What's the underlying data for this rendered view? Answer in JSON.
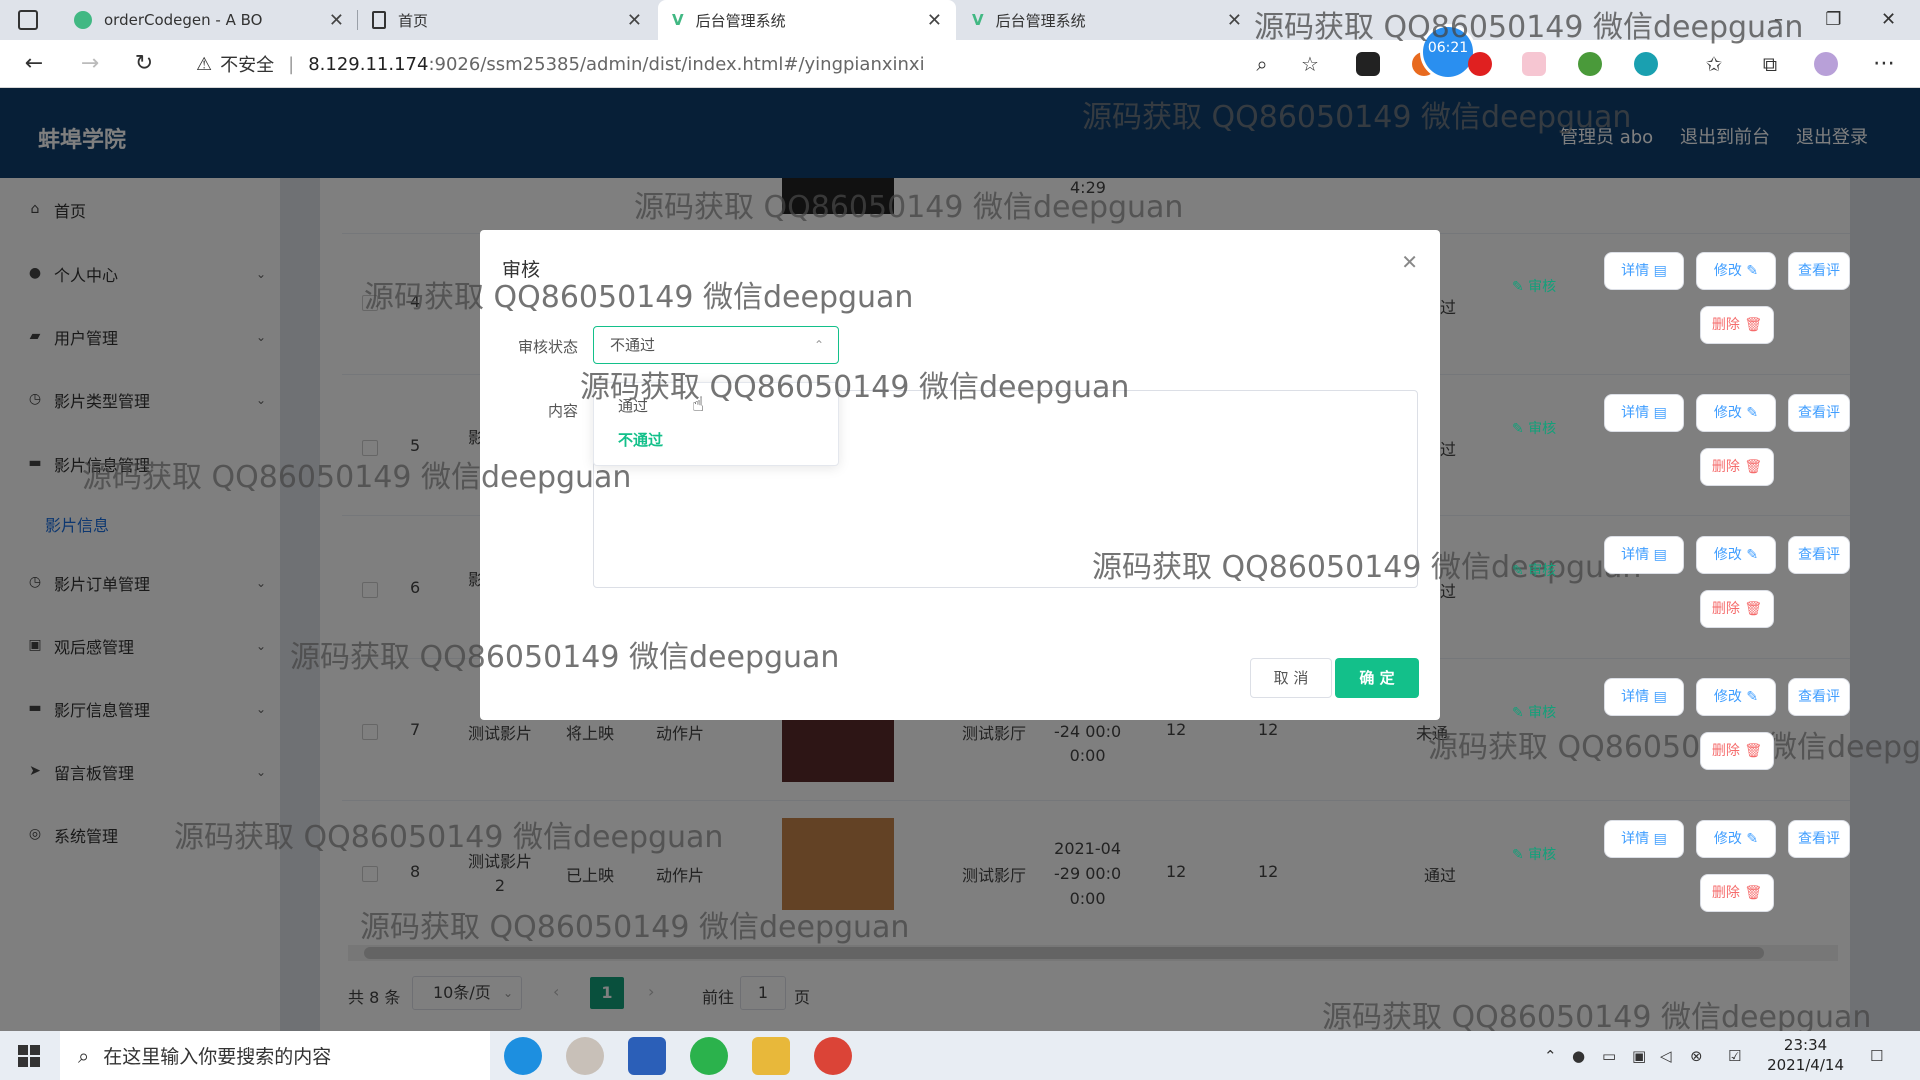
{
  "browser": {
    "tabs": [
      {
        "title": "orderCodegen - A BO"
      },
      {
        "title": "首页"
      },
      {
        "title": "后台管理系统"
      },
      {
        "title": "后台管理系统"
      }
    ],
    "security_label": "不安全",
    "url_host": "8.129.11.174",
    "url_rest": ":9026/ssm25385/admin/dist/index.html#/yingpianxinxi",
    "clock_badge": "06:21"
  },
  "header": {
    "brand": "蚌埠学院",
    "user": "管理员 abo",
    "to_front": "退出到前台",
    "logout": "退出登录"
  },
  "sidebar": {
    "items": [
      {
        "label": "首页",
        "icon": "home-icon"
      },
      {
        "label": "个人中心",
        "icon": "user-icon"
      },
      {
        "label": "用户管理",
        "icon": "users-icon"
      },
      {
        "label": "影片类型管理",
        "icon": "clock-icon"
      },
      {
        "label": "影片信息管理",
        "icon": "monitor-icon"
      },
      {
        "label": "影片订单管理",
        "icon": "clock-icon"
      },
      {
        "label": "观后感管理",
        "icon": "doc-icon"
      },
      {
        "label": "影厅信息管理",
        "icon": "monitor-icon"
      },
      {
        "label": "留言板管理",
        "icon": "send-icon"
      },
      {
        "label": "系统管理",
        "icon": "settings-icon"
      }
    ],
    "sub_item": "影片信息"
  },
  "table": {
    "rows": [
      {
        "idx": "4",
        "name": "影",
        "status": "",
        "type": "",
        "hall": "",
        "time": "4:29",
        "a": "",
        "b": "",
        "audit": "过"
      },
      {
        "idx": "5",
        "name": "影",
        "status": "",
        "type": "",
        "hall": "",
        "time": "",
        "a": "",
        "b": "",
        "audit": "过"
      },
      {
        "idx": "6",
        "name": "影",
        "status": "",
        "type": "",
        "hall": "",
        "time": "",
        "a": "",
        "b": "",
        "audit": "过"
      },
      {
        "idx": "7",
        "name": "测试影片",
        "status": "将上映",
        "type": "动作片",
        "hall": "测试影厅",
        "time": "-24 00:0\n0:00",
        "a": "12",
        "b": "12",
        "audit": "未通"
      },
      {
        "idx": "8",
        "name": "测试影片\n2",
        "status": "已上映",
        "type": "动作片",
        "hall": "测试影厅",
        "time": "2021-04\n-29 00:0\n0:00",
        "a": "12",
        "b": "12",
        "audit": "通过"
      }
    ],
    "btn_detail": "详情 ▤",
    "btn_edit": "修改 ✎",
    "btn_review": "查看评",
    "btn_delete": "删除 🗑",
    "btn_audit": "✎ 审核"
  },
  "pager": {
    "total": "共 8 条",
    "page_size": "10条/页",
    "current": "1",
    "goto_label": "前往",
    "goto_value": "1",
    "page_unit": "页"
  },
  "dialog": {
    "title": "审核",
    "status_label": "审核状态",
    "status_value": "不通过",
    "content_label": "内容",
    "cancel": "取 消",
    "ok": "确 定",
    "options": [
      "通过",
      "不通过"
    ]
  },
  "watermark": "源码获取 QQ86050149 微信deepguan",
  "taskbar": {
    "search_placeholder": "在这里输入你要搜索的内容",
    "time": "23:34",
    "date": "2021/4/14"
  },
  "colors": {
    "header": "#0f3e6e",
    "accent": "#13c08a",
    "link": "#409eff",
    "danger": "#f56c6c"
  }
}
